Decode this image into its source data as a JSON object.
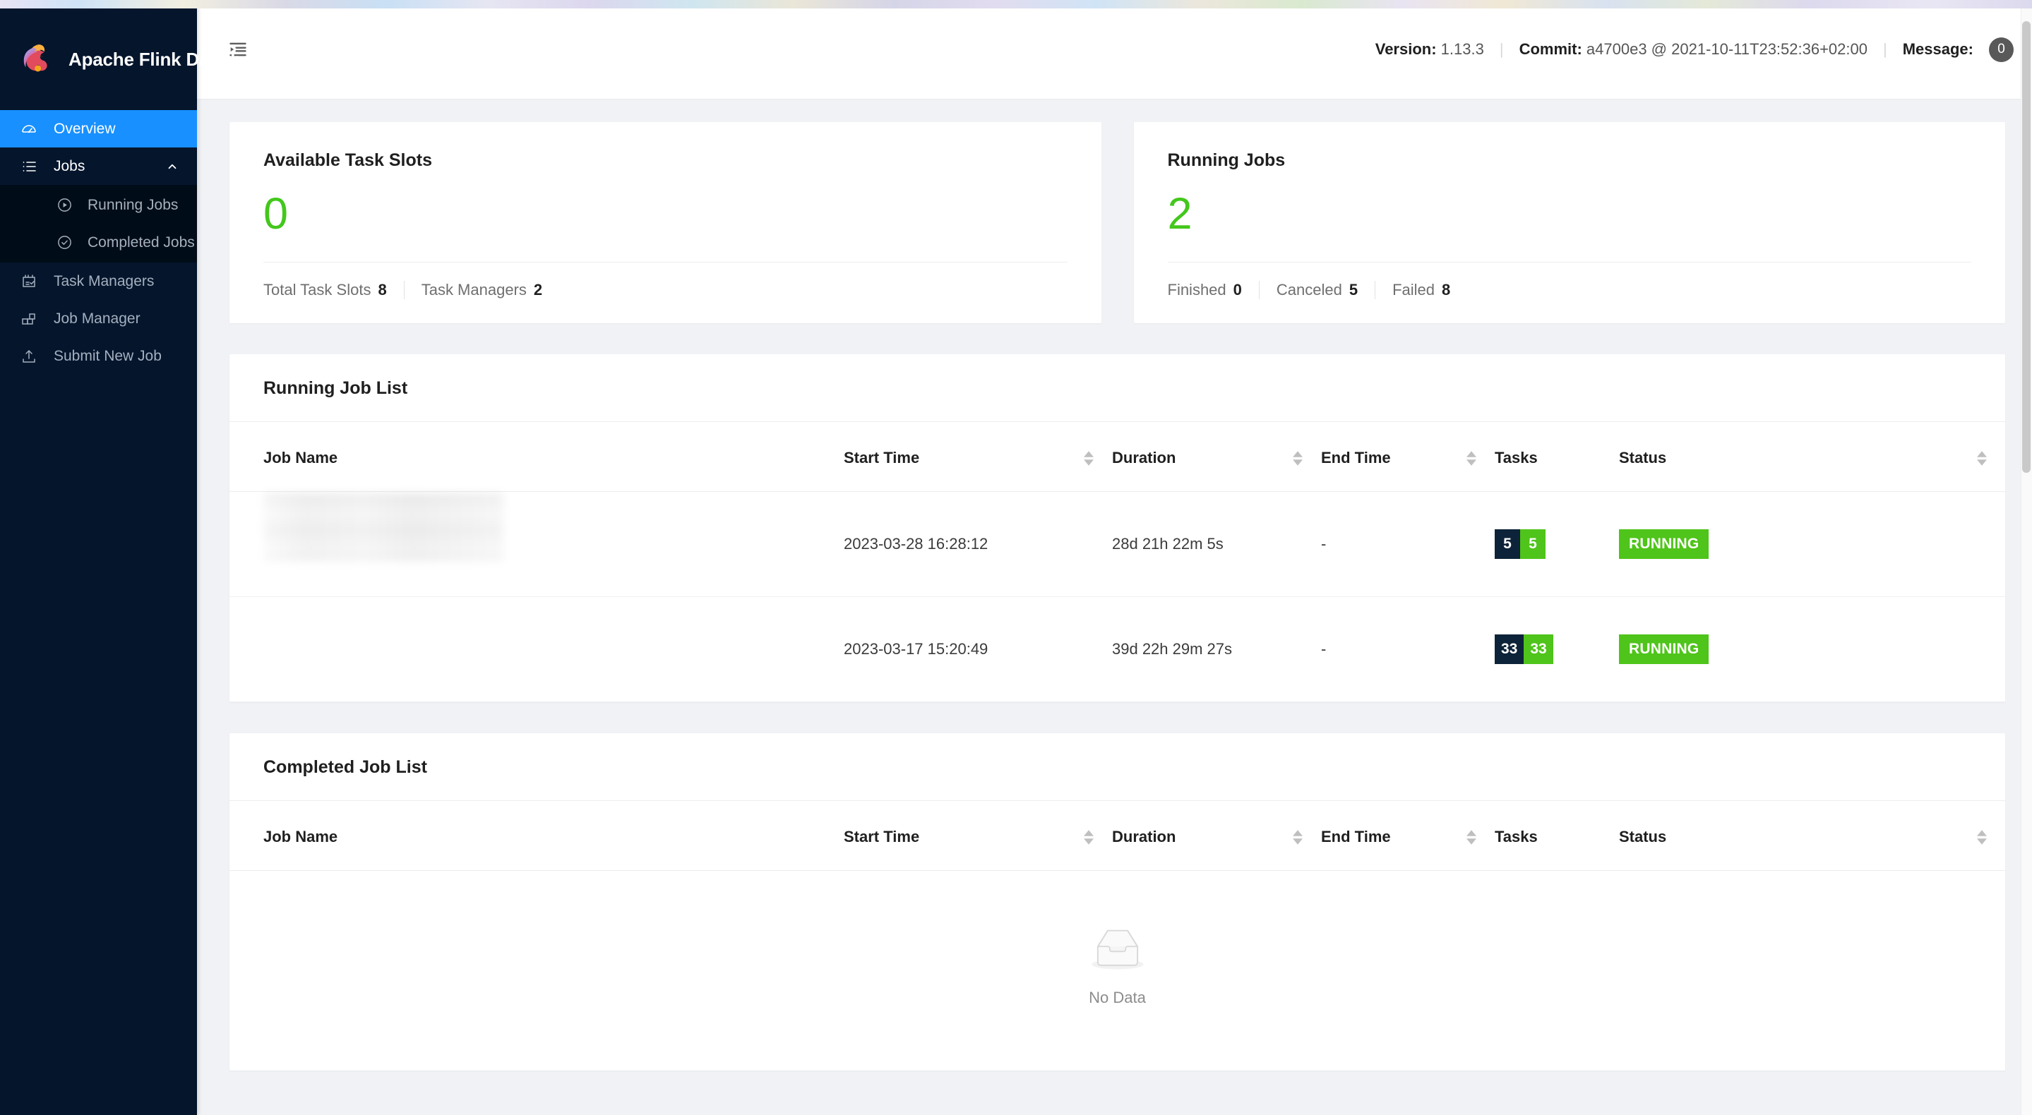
{
  "brand": {
    "title": "Apache Flink Dashboard",
    "logo_icon": "flink-squirrel-logo"
  },
  "sidebar": {
    "items": [
      {
        "label": "Overview",
        "icon": "dashboard-icon",
        "state": "active"
      },
      {
        "label": "Jobs",
        "icon": "list-icon",
        "state": "expanded",
        "chevron": "chevron-up-icon"
      },
      {
        "label": "Running Jobs",
        "icon": "play-circle-icon",
        "state": "sub"
      },
      {
        "label": "Completed Jobs",
        "icon": "check-circle-icon",
        "state": "sub"
      },
      {
        "label": "Task Managers",
        "icon": "clipboard-check-icon",
        "state": "normal"
      },
      {
        "label": "Job Manager",
        "icon": "blocks-icon",
        "state": "normal"
      },
      {
        "label": "Submit New Job",
        "icon": "upload-icon",
        "state": "normal"
      }
    ]
  },
  "topbar": {
    "fold_icon": "menu-fold-icon",
    "version_label": "Version:",
    "version_value": "1.13.3",
    "commit_label": "Commit:",
    "commit_value": "a4700e3 @ 2021-10-11T23:52:36+02:00",
    "message_label": "Message:",
    "message_count": "0",
    "separator": "|"
  },
  "cards": {
    "task_slots": {
      "title": "Available Task Slots",
      "value": "0",
      "value_color": "#43c71c",
      "sub": [
        {
          "label": "Total Task Slots",
          "value": "8"
        },
        {
          "label": "Task Managers",
          "value": "2"
        }
      ]
    },
    "running_jobs": {
      "title": "Running Jobs",
      "value": "2",
      "value_color": "#43c71c",
      "sub": [
        {
          "label": "Finished",
          "value": "0"
        },
        {
          "label": "Canceled",
          "value": "5"
        },
        {
          "label": "Failed",
          "value": "8"
        }
      ]
    }
  },
  "running_job_list": {
    "title": "Running Job List",
    "columns": [
      "Job Name",
      "Start Time",
      "Duration",
      "End Time",
      "Tasks",
      "Status"
    ],
    "rows": [
      {
        "job_name": "",
        "start_time": "2023-03-28 16:28:12",
        "duration": "28d 21h 22m 5s",
        "end_time": "-",
        "tasks_dark": "5",
        "tasks_green": "5",
        "status": "RUNNING"
      },
      {
        "job_name": "",
        "start_time": "2023-03-17 15:20:49",
        "duration": "39d 22h 29m 27s",
        "end_time": "-",
        "tasks_dark": "33",
        "tasks_green": "33",
        "status": "RUNNING"
      }
    ]
  },
  "completed_job_list": {
    "title": "Completed Job List",
    "columns": [
      "Job Name",
      "Start Time",
      "Duration",
      "End Time",
      "Tasks",
      "Status"
    ],
    "empty_label": "No Data",
    "empty_icon": "empty-inbox-icon",
    "rows": []
  },
  "colors": {
    "sidebar_bg": "#04152c",
    "submenu_bg": "#000c17",
    "accent_blue": "#1890ff",
    "status_green": "#4fc41a",
    "tasks_dark": "#0d2339",
    "page_bg": "#f0f2f5"
  }
}
